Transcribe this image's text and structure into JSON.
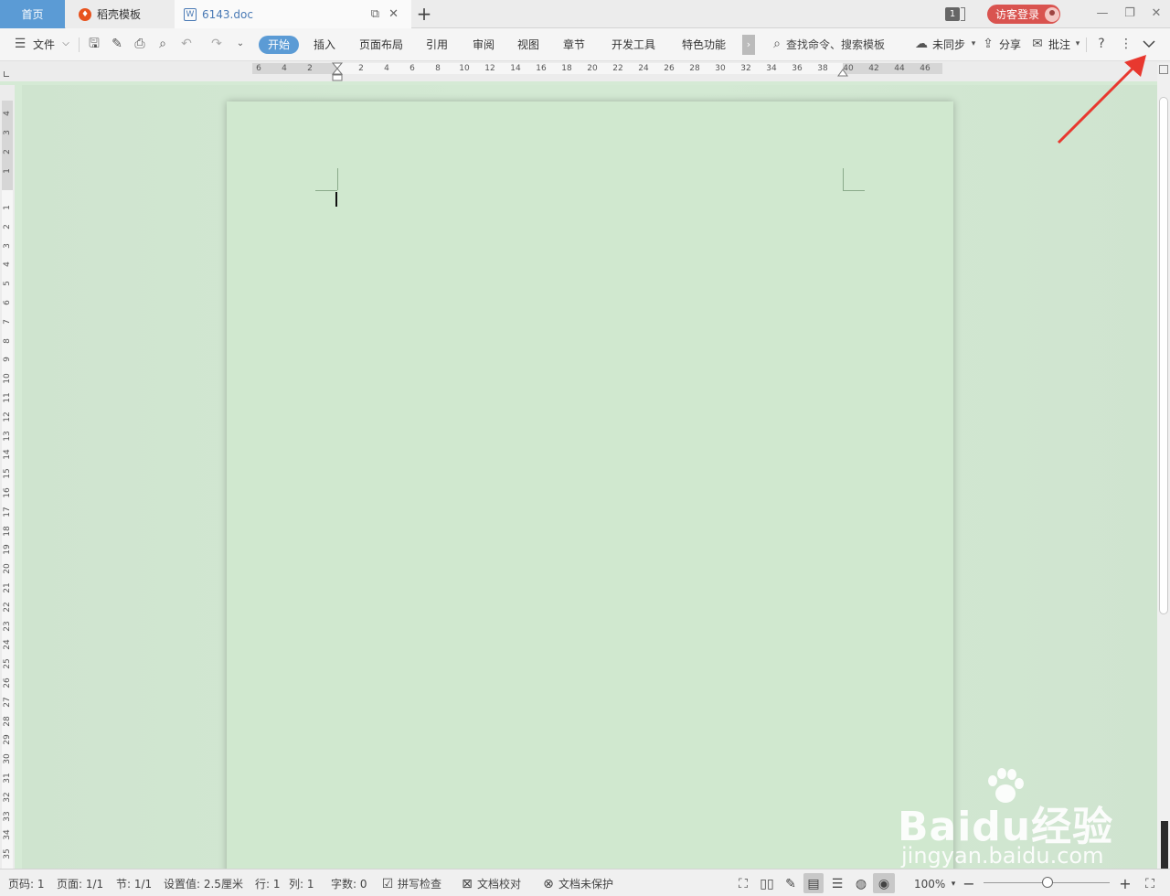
{
  "tabs": {
    "home": "首页",
    "template": "稻壳模板",
    "document": "6143.doc"
  },
  "titlebar": {
    "window_count": "1",
    "login_label": "访客登录"
  },
  "ribbon": {
    "file_menu": "文件",
    "tabs": [
      "开始",
      "插入",
      "页面布局",
      "引用",
      "审阅",
      "视图",
      "章节",
      "开发工具",
      "特色功能"
    ],
    "search_placeholder": "查找命令、搜索模板",
    "sync_label": "未同步",
    "share_label": "分享",
    "comment_label": "批注"
  },
  "ruler": {
    "horizontal": [
      "6",
      "4",
      "2",
      "2",
      "4",
      "6",
      "8",
      "10",
      "12",
      "14",
      "16",
      "18",
      "20",
      "22",
      "24",
      "26",
      "28",
      "30",
      "32",
      "34",
      "36",
      "38",
      "40",
      "42",
      "44",
      "46"
    ],
    "vertical": [
      "4",
      "3",
      "2",
      "1",
      "1",
      "2",
      "3",
      "4",
      "5",
      "6",
      "7",
      "8",
      "9",
      "10",
      "11",
      "12",
      "13",
      "14",
      "15",
      "16",
      "17",
      "18",
      "19",
      "20",
      "21",
      "22",
      "23",
      "24",
      "25",
      "26",
      "27",
      "28",
      "29",
      "30",
      "31",
      "32",
      "33",
      "34",
      "35"
    ]
  },
  "status": {
    "page_num": "页码: 1",
    "pages": "页面: 1/1",
    "section": "节: 1/1",
    "setting": "设置值: 2.5厘米",
    "row": "行: 1",
    "col": "列: 1",
    "word_count": "字数: 0",
    "spell_check": "拼写检查",
    "proofread": "文档校对",
    "protection": "文档未保护",
    "zoom": "100%"
  },
  "watermark": {
    "brand": "Baidu经验",
    "url": "jingyan.baidu.com"
  },
  "colors": {
    "accent": "#5b9bd5",
    "login": "#d9534f",
    "canvas": "#d3e9d3",
    "page": "#d0e8cf",
    "annotation_arrow": "#e8382f"
  }
}
